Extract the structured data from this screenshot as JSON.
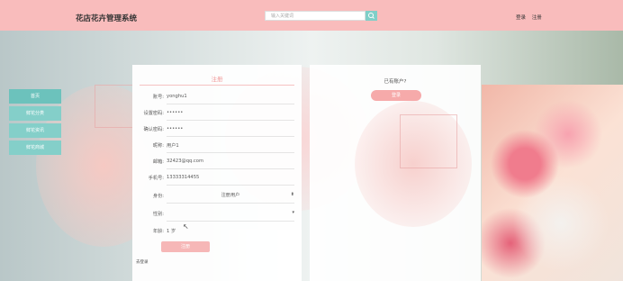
{
  "header": {
    "title": "花店花卉管理系统",
    "search_placeholder": "输入关键词",
    "search_icon": "search-icon",
    "login_label": "登录",
    "register_label": "注册"
  },
  "sidebar": {
    "items": [
      {
        "label": "首页"
      },
      {
        "label": "鲜花分类"
      },
      {
        "label": "鲜花资讯"
      },
      {
        "label": "鲜花商城"
      }
    ]
  },
  "register_form": {
    "title": "注册",
    "fields": [
      {
        "label": "账号:",
        "value": "yonghu1"
      },
      {
        "label": "设置密码:",
        "value": "••••••"
      },
      {
        "label": "确认密码:",
        "value": "••••••"
      },
      {
        "label": "昵称:",
        "value": "用户1"
      },
      {
        "label": "邮箱:",
        "value": "32423@qq.com"
      },
      {
        "label": "手机号:",
        "value": "13333314455"
      },
      {
        "label": "身份:",
        "value": "注册用户"
      },
      {
        "label": "性别:",
        "value": ""
      },
      {
        "label": "年龄:",
        "value": "1 岁"
      }
    ],
    "submit_label": "注册",
    "login_link": "去登录"
  },
  "login_prompt": {
    "question": "已有账户?",
    "button_label": "登录"
  },
  "colors": {
    "header_bg": "#f9bcbc",
    "accent_teal": "#84cfc9",
    "accent_pink": "#f8b6b6"
  }
}
